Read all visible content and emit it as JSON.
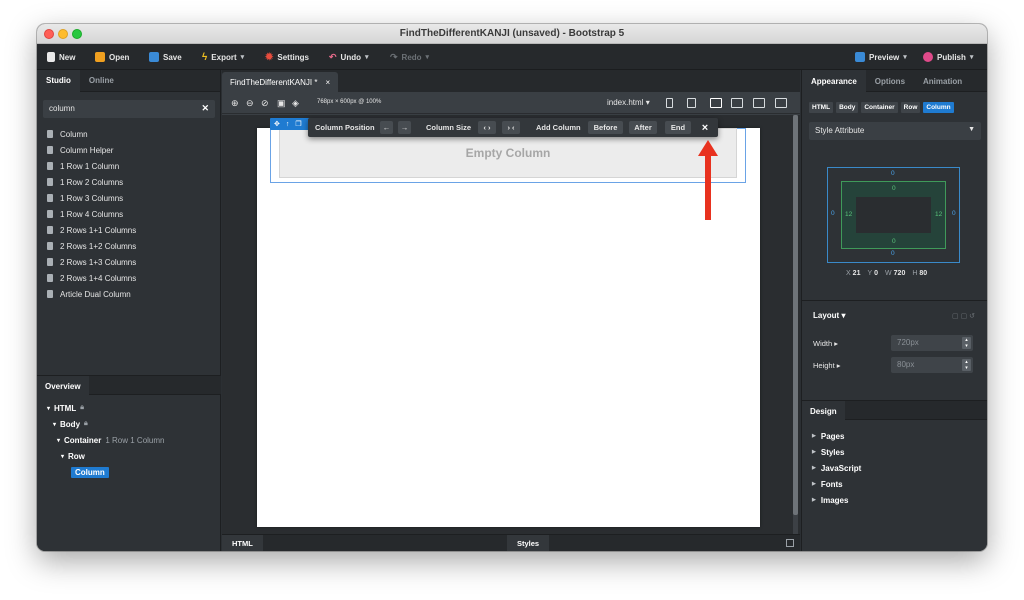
{
  "window": {
    "title": "FindTheDifferentKANJI (unsaved) - Bootstrap 5"
  },
  "toolbar": {
    "new": "New",
    "open": "Open",
    "save": "Save",
    "export": "Export",
    "settings": "Settings",
    "undo": "Undo",
    "redo": "Redo",
    "preview": "Preview",
    "publish": "Publish"
  },
  "left": {
    "tabs": [
      "Studio",
      "Online"
    ],
    "search_value": "column",
    "components": [
      "Column",
      "Column Helper",
      "1 Row 1 Column",
      "1 Row 2 Columns",
      "1 Row 3 Columns",
      "1 Row 4 Columns",
      "2 Rows 1+1 Columns",
      "2 Rows 1+2 Columns",
      "2 Rows 1+3 Columns",
      "2 Rows 1+4 Columns",
      "Article Dual Column"
    ],
    "overview_tab": "Overview",
    "tree": {
      "html": "HTML",
      "body": "Body",
      "container": "Container",
      "container_sub": "1 Row 1 Column",
      "row": "Row",
      "column": "Column"
    }
  },
  "center": {
    "doc_tab": "FindTheDifferentKANJI *",
    "doc_tab_close": "×",
    "size_label": "768px × 600px @ 100%",
    "page_select": "index.html",
    "empty_column": "Empty Column",
    "floatbar": {
      "position": "Column Position",
      "size": "Column Size",
      "add": "Add Column",
      "before": "Before",
      "after": "After",
      "end": "End",
      "close": "×"
    },
    "bottom_tabs": {
      "html": "HTML",
      "styles": "Styles"
    }
  },
  "right": {
    "tabs": [
      "Appearance",
      "Options",
      "Animation"
    ],
    "crumbs": [
      "HTML",
      "Body",
      "Container",
      "Row",
      "Column"
    ],
    "style_attr": "Style Attribute",
    "boxmodel": {
      "margin_top": "0",
      "margin_bottom": "0",
      "margin_left": "0",
      "margin_right": "0",
      "padding_top": "0",
      "padding_bottom": "0",
      "padding_left": "12",
      "padding_right": "12"
    },
    "xywh": {
      "x": "21",
      "y": "0",
      "w": "720",
      "h": "80"
    },
    "layout": "Layout",
    "width_label": "Width",
    "width_value": "720px",
    "height_label": "Height",
    "height_value": "80px",
    "design_tab": "Design",
    "design_items": [
      "Pages",
      "Styles",
      "JavaScript",
      "Fonts",
      "Images"
    ]
  },
  "colors": {
    "accent": "#1f7bd1",
    "arrow": "#e8321f",
    "panel": "#2e3236"
  },
  "icons": {
    "arrow": "red-arrow-pointing-up-to-close-button"
  }
}
